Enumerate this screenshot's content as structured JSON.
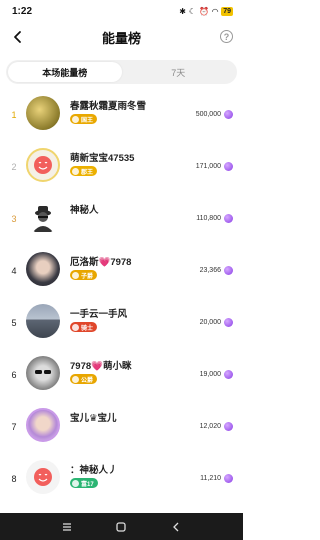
{
  "status": {
    "time": "1:22",
    "battery": "79"
  },
  "header": {
    "title": "能量榜"
  },
  "tabs": [
    {
      "label": "本场能量榜",
      "active": true
    },
    {
      "label": "7天",
      "active": false
    }
  ],
  "rows": [
    {
      "rank": "1",
      "name": "春露秋霜夏雨冬雪",
      "badge": "国王",
      "score": "500,000",
      "rank_color": "#e0a800",
      "badge_color": "#e9a800",
      "avatar": "forest"
    },
    {
      "rank": "2",
      "name": "萌新宝宝47535",
      "badge": "郡王",
      "score": "171,000",
      "rank_color": "#b0b0b0",
      "badge_color": "#ecb000",
      "avatar": "sticker"
    },
    {
      "rank": "3",
      "name": "神秘人",
      "badge": "",
      "score": "110,800",
      "rank_color": "#d99a3a",
      "badge_color": "",
      "avatar": "mystery"
    },
    {
      "rank": "4",
      "name": "厄洛斯💗7978",
      "badge": "子爵",
      "score": "23,366",
      "rank_color": "#333333",
      "badge_color": "#e8a600",
      "avatar": "girl"
    },
    {
      "rank": "5",
      "name": "一手云一手风",
      "badge": "骑士",
      "score": "20,000",
      "rank_color": "#333333",
      "badge_color": "#e0472b",
      "avatar": "city"
    },
    {
      "rank": "6",
      "name": "7978💗萌小眯",
      "badge": "公爵",
      "score": "19,000",
      "rank_color": "#333333",
      "badge_color": "#e8a600",
      "avatar": "bw"
    },
    {
      "rank": "7",
      "name": "宝儿♛宝儿",
      "badge": "",
      "score": "12,020",
      "rank_color": "#333333",
      "badge_color": "",
      "avatar": "framed"
    },
    {
      "rank": "8",
      "name": "：神秘人丿",
      "badge": "富17",
      "score": "11,210",
      "rank_color": "#333333",
      "badge_color": "#2bb573",
      "avatar": "sticker2"
    }
  ],
  "icons": {
    "back": "back-arrow-icon",
    "help": "help-icon",
    "energy": "energy-orb-icon"
  },
  "colors": {
    "accent_purple": "#8a3ee6",
    "tab_bg": "#f1f1f1",
    "nav_bg": "#1b1b1b"
  }
}
